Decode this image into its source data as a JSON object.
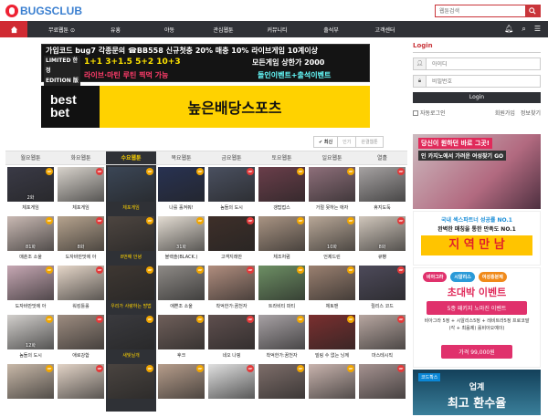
{
  "header": {
    "logo": "BUGSCLUB",
    "search_placeholder": "웹툰검색"
  },
  "nav": {
    "items": [
      "무료웹툰 ⊙",
      "유흥",
      "야동",
      "관심웹툰",
      "커뮤니티",
      "출석부",
      "고객센터"
    ],
    "icons": [
      "home-icon",
      "bell-icon",
      "search-icon",
      "menu-icon"
    ]
  },
  "banner_top": {
    "line1": "가입코드 bug7 각종문의 ☎BB558 신규첫충 20% 매충 10% 라이브게임 10계이상",
    "left": [
      "LIMITED 한정",
      "EDITION 版판"
    ],
    "bonus": "1+1  3+1.5  5+2  10+3",
    "bonus_right": "모든게임 상한가 2000",
    "events": "라이브·마틴 루틴 찍먹 가능",
    "events_right": "돌인이벤트+출석이벤트"
  },
  "banner_bet": {
    "logo_top": "best",
    "logo_bottom": "bet",
    "slogan": "높은배당스포츠"
  },
  "login": {
    "title": "Login",
    "id_placeholder": "아이디",
    "pw_placeholder": "비밀번호",
    "button": "Login",
    "auto": "자동로그인",
    "signup": "회원가입",
    "find": "정보찾기"
  },
  "sort": [
    "✔ 최신",
    "인기",
    "완결웹툰"
  ],
  "tabs": [
    "월요웹툰",
    "화요웹툰",
    "수요웹툰",
    "목요웹툰",
    "금요웹툰",
    "토요웹툰",
    "일요웹툰",
    "열흘"
  ],
  "active_tab": 2,
  "grid": [
    [
      {
        "title": "체포게임",
        "num": "2화",
        "badge": "UP",
        "color": "#3a3a46"
      },
      {
        "title": "체포게임",
        "num": "",
        "badge": "UP",
        "color": "#d8d3cc"
      },
      {
        "title": "체포게임",
        "num": "",
        "badge": "UP",
        "color": "#3b4656",
        "hl": true
      },
      {
        "title": "나를 홀켜줘!",
        "num": "",
        "badge": "UP",
        "color": "#283252"
      },
      {
        "title": "놈들의 도시",
        "num": "",
        "badge": "UP",
        "color": "#4a5060"
      },
      {
        "title": "갱탑접스",
        "num": "",
        "badge": "UP",
        "color": "#6a3e4a"
      },
      {
        "title": "거절 못하는 애자",
        "num": "",
        "badge": "UP",
        "color": "#8e6f7a"
      },
      {
        "title": "휴지도둑",
        "num": "",
        "badge": "UP",
        "color": "#a6a2a2"
      }
    ],
    [
      {
        "title": "매춘조 소울",
        "num": "81화",
        "badge": "UP",
        "color": "#c9b9b3"
      },
      {
        "title": "도자바만맛에 아",
        "num": "8화",
        "badge": "UP",
        "color": "#b6a38e"
      },
      {
        "title": "8번째 안녕",
        "num": "",
        "badge": "UP",
        "color": "#4d4540",
        "hl": true
      },
      {
        "title": "블랙솔(BLACK.)",
        "num": "31화",
        "badge": "UP",
        "color": "#e3dcd2"
      },
      {
        "title": "고객지래만",
        "num": "",
        "badge": "UP",
        "color": "#3e2f29"
      },
      {
        "title": "체조처럼",
        "num": "",
        "badge": "UP",
        "color": "#a99483"
      },
      {
        "title": "언제드린",
        "num": "10화",
        "badge": "UP",
        "color": "#b8a797"
      },
      {
        "title": "큐빵",
        "num": "8화",
        "badge": "UP",
        "color": "#d0c6bb"
      }
    ],
    [
      {
        "title": "도자바만맛에 아",
        "num": "",
        "badge": "UP",
        "color": "#c6a7b3"
      },
      {
        "title": "워킹틀롤",
        "num": "",
        "badge": "UP",
        "color": "#e5d6c8"
      },
      {
        "title": "우리가 사랑하는 방법",
        "num": "",
        "badge": "UP",
        "color": "#3e3732",
        "hl": true
      },
      {
        "title": "애쁜조 소울",
        "num": "",
        "badge": "UP",
        "color": "#8e8a86"
      },
      {
        "title": "착억한가:꿈천자",
        "num": "",
        "badge": "UP",
        "color": "#b08d7e"
      },
      {
        "title": "트라비티 파티",
        "num": "",
        "badge": "UP",
        "color": "#6d8f64"
      },
      {
        "title": "체토맨",
        "num": "",
        "badge": "UP",
        "color": "#9a8070"
      },
      {
        "title": "릴리스 코드",
        "num": "",
        "badge": "UP",
        "color": "#4d4a5a"
      }
    ],
    [
      {
        "title": "놈들의 도시",
        "num": "12화",
        "badge": "UP",
        "color": "#d2cfcc"
      },
      {
        "title": "애로강합",
        "num": "",
        "badge": "UP",
        "color": "#9d8c80"
      },
      {
        "title": "새빛닐개",
        "num": "",
        "badge": "UP",
        "color": "#3a3a3e",
        "hl": true
      },
      {
        "title": "후크",
        "num": "",
        "badge": "UP",
        "color": "#6f5f5a"
      },
      {
        "title": "네오 나핑",
        "num": "",
        "badge": "UP",
        "color": "#5f4f4e"
      },
      {
        "title": "착억한가:꿈천자",
        "num": "",
        "badge": "UP",
        "color": "#a7a1a4"
      },
      {
        "title": "빌링 수 없는 닝께",
        "num": "",
        "badge": "UP",
        "color": "#7a2f2f"
      },
      {
        "title": "마스테시직",
        "num": "",
        "badge": "UP",
        "color": "#b7a6a0"
      }
    ],
    [
      {
        "title": "",
        "num": "",
        "badge": "UP",
        "color": "#c8b8a8"
      },
      {
        "title": "",
        "num": "",
        "badge": "UP",
        "color": "#e2d3c6"
      },
      {
        "title": "",
        "num": "",
        "badge": "UP",
        "color": "#4a4440",
        "hl": true
      },
      {
        "title": "",
        "num": "",
        "badge": "UP",
        "color": "#b69d8b"
      },
      {
        "title": "",
        "num": "",
        "badge": "UP",
        "color": "#e0e0e0"
      },
      {
        "title": "",
        "num": "",
        "badge": "UP",
        "color": "#7e6e6a"
      },
      {
        "title": "",
        "num": "",
        "badge": "UP",
        "color": "#c8b3ad"
      },
      {
        "title": "",
        "num": "",
        "badge": "UP",
        "color": "#a59290"
      }
    ]
  ],
  "side_ads": {
    "ad1": {
      "a": "당신이 원하던 바로 그곳!",
      "b": "인 카지노에서 가려운 여성찾기 GO"
    },
    "ad2": {
      "a": "국내 섹스파트너 성공률 NO.1",
      "b": "완벽한 매칭을 통한 만족도 NO.1",
      "c": "지 역 만 남"
    },
    "ad3": {
      "pills": [
        "비아그라",
        "시알리스",
        "여성흥분제"
      ],
      "big": "초대박 이벤트",
      "pkg": "5종 패키지 노마진 이벤트",
      "txt": "비아그라 5정 + 시알리스5정 + 레비트라5정 프로코말 (각 + 최음제) 롤비아오예이)",
      "price": "가격 99,000원"
    },
    "ad4": {
      "a": "코드확스",
      "b": "업계",
      "c": "최고 환수율"
    }
  }
}
